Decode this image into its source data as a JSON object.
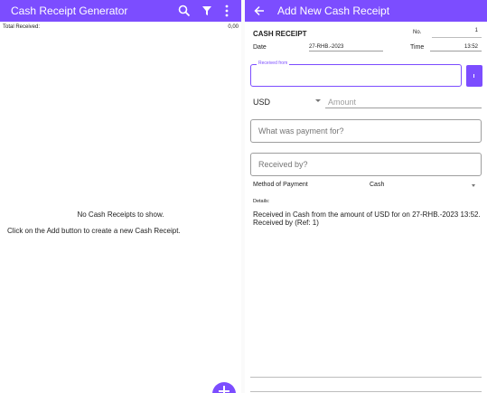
{
  "left": {
    "title": "Cash Receipt Generator",
    "icons": [
      "search-icon",
      "filter-icon",
      "more-vert-icon"
    ],
    "total_label": "Total Received:",
    "total_value": "0,00",
    "empty_title": "No Cash Receipts to show.",
    "empty_sub": "Click on the Add button to create a new Cash Receipt.",
    "fab_icon": "add-icon"
  },
  "right": {
    "title": "Add New Cash Receipt",
    "back_icon": "arrow-back-icon",
    "receipt_title": "CASH RECEIPT",
    "no_label": "No.",
    "no_value": "1",
    "date_label": "Date",
    "date_value": "27-RHB.-2023",
    "time_label": "Time",
    "time_value": "13:52",
    "received_from_label": "Received from",
    "received_from_value": "",
    "currency": "USD",
    "amount_placeholder": "Amount",
    "purpose_placeholder": "What was payment for?",
    "received_by_placeholder": "Received by?",
    "method_label": "Method of Payment",
    "method_value": "Cash",
    "details_label": "Details:",
    "details_text": "Received in Cash from  the amount of USD  for  on 27-RHB.-2023 13:52. Received by  (Ref: 1)"
  },
  "colors": {
    "accent": "#7c4dff",
    "text": "#212121",
    "hint": "#9e9e9e"
  }
}
